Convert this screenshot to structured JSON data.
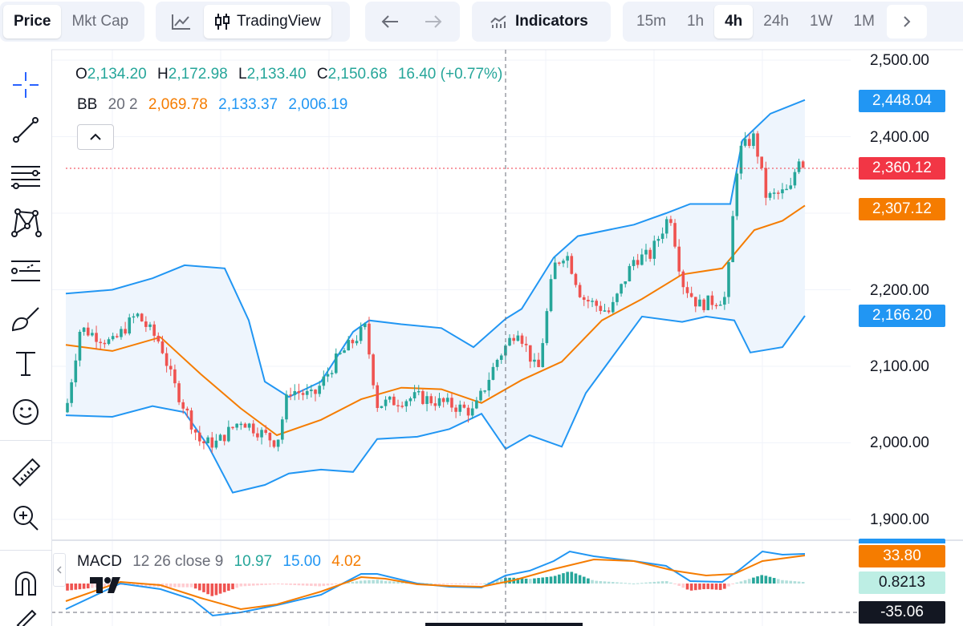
{
  "toolbar": {
    "price_label": "Price",
    "mktcap_label": "Mkt Cap",
    "tradingview_label": "TradingView",
    "indicators_label": "Indicators",
    "timeframes": [
      "15m",
      "1h",
      "4h",
      "24h",
      "1W",
      "1M"
    ],
    "active_timeframe": "4h"
  },
  "legend": {
    "o_label": "O",
    "o_value": "2,134.20",
    "h_label": "H",
    "h_value": "2,172.98",
    "l_label": "L",
    "l_value": "2,133.40",
    "c_label": "C",
    "c_value": "2,150.68",
    "change": "16.40 (+0.77%)",
    "bb_name": "BB",
    "bb_params": "20 2",
    "bb_basis": "2,069.78",
    "bb_upper": "2,133.37",
    "bb_lower": "2,006.19"
  },
  "macd_legend": {
    "name": "MACD",
    "params": "12 26 close 9",
    "histogram": "10.97",
    "macd": "15.00",
    "signal": "4.02"
  },
  "price_axis": {
    "labels": [
      "2,500.00",
      "2,400.00",
      "2,200.00",
      "2,100.00",
      "2,000.00",
      "1,900.00"
    ]
  },
  "price_tags": {
    "bb_upper": "2,448.04",
    "last_price": "2,360.12",
    "bb_basis": "2,307.12",
    "bb_lower": "2,166.20"
  },
  "macd_tags": {
    "signal": "33.80",
    "histogram": "0.8213",
    "crosshair": "-35.06"
  },
  "colors": {
    "up": "#26a69a",
    "down": "#ef5350",
    "bb_basis": "#f57c00",
    "bb_band": "#2196f3",
    "band_fill": "#eef5fd",
    "last_price": "#f23645",
    "dark_tag": "#131722"
  },
  "icons": [
    "crosshair-icon",
    "trend-line-icon",
    "fib-icon",
    "pattern-icon",
    "projection-icon",
    "brush-icon",
    "text-icon",
    "emoji-icon",
    "ruler-icon",
    "zoom-in-icon",
    "magnet-icon"
  ]
}
